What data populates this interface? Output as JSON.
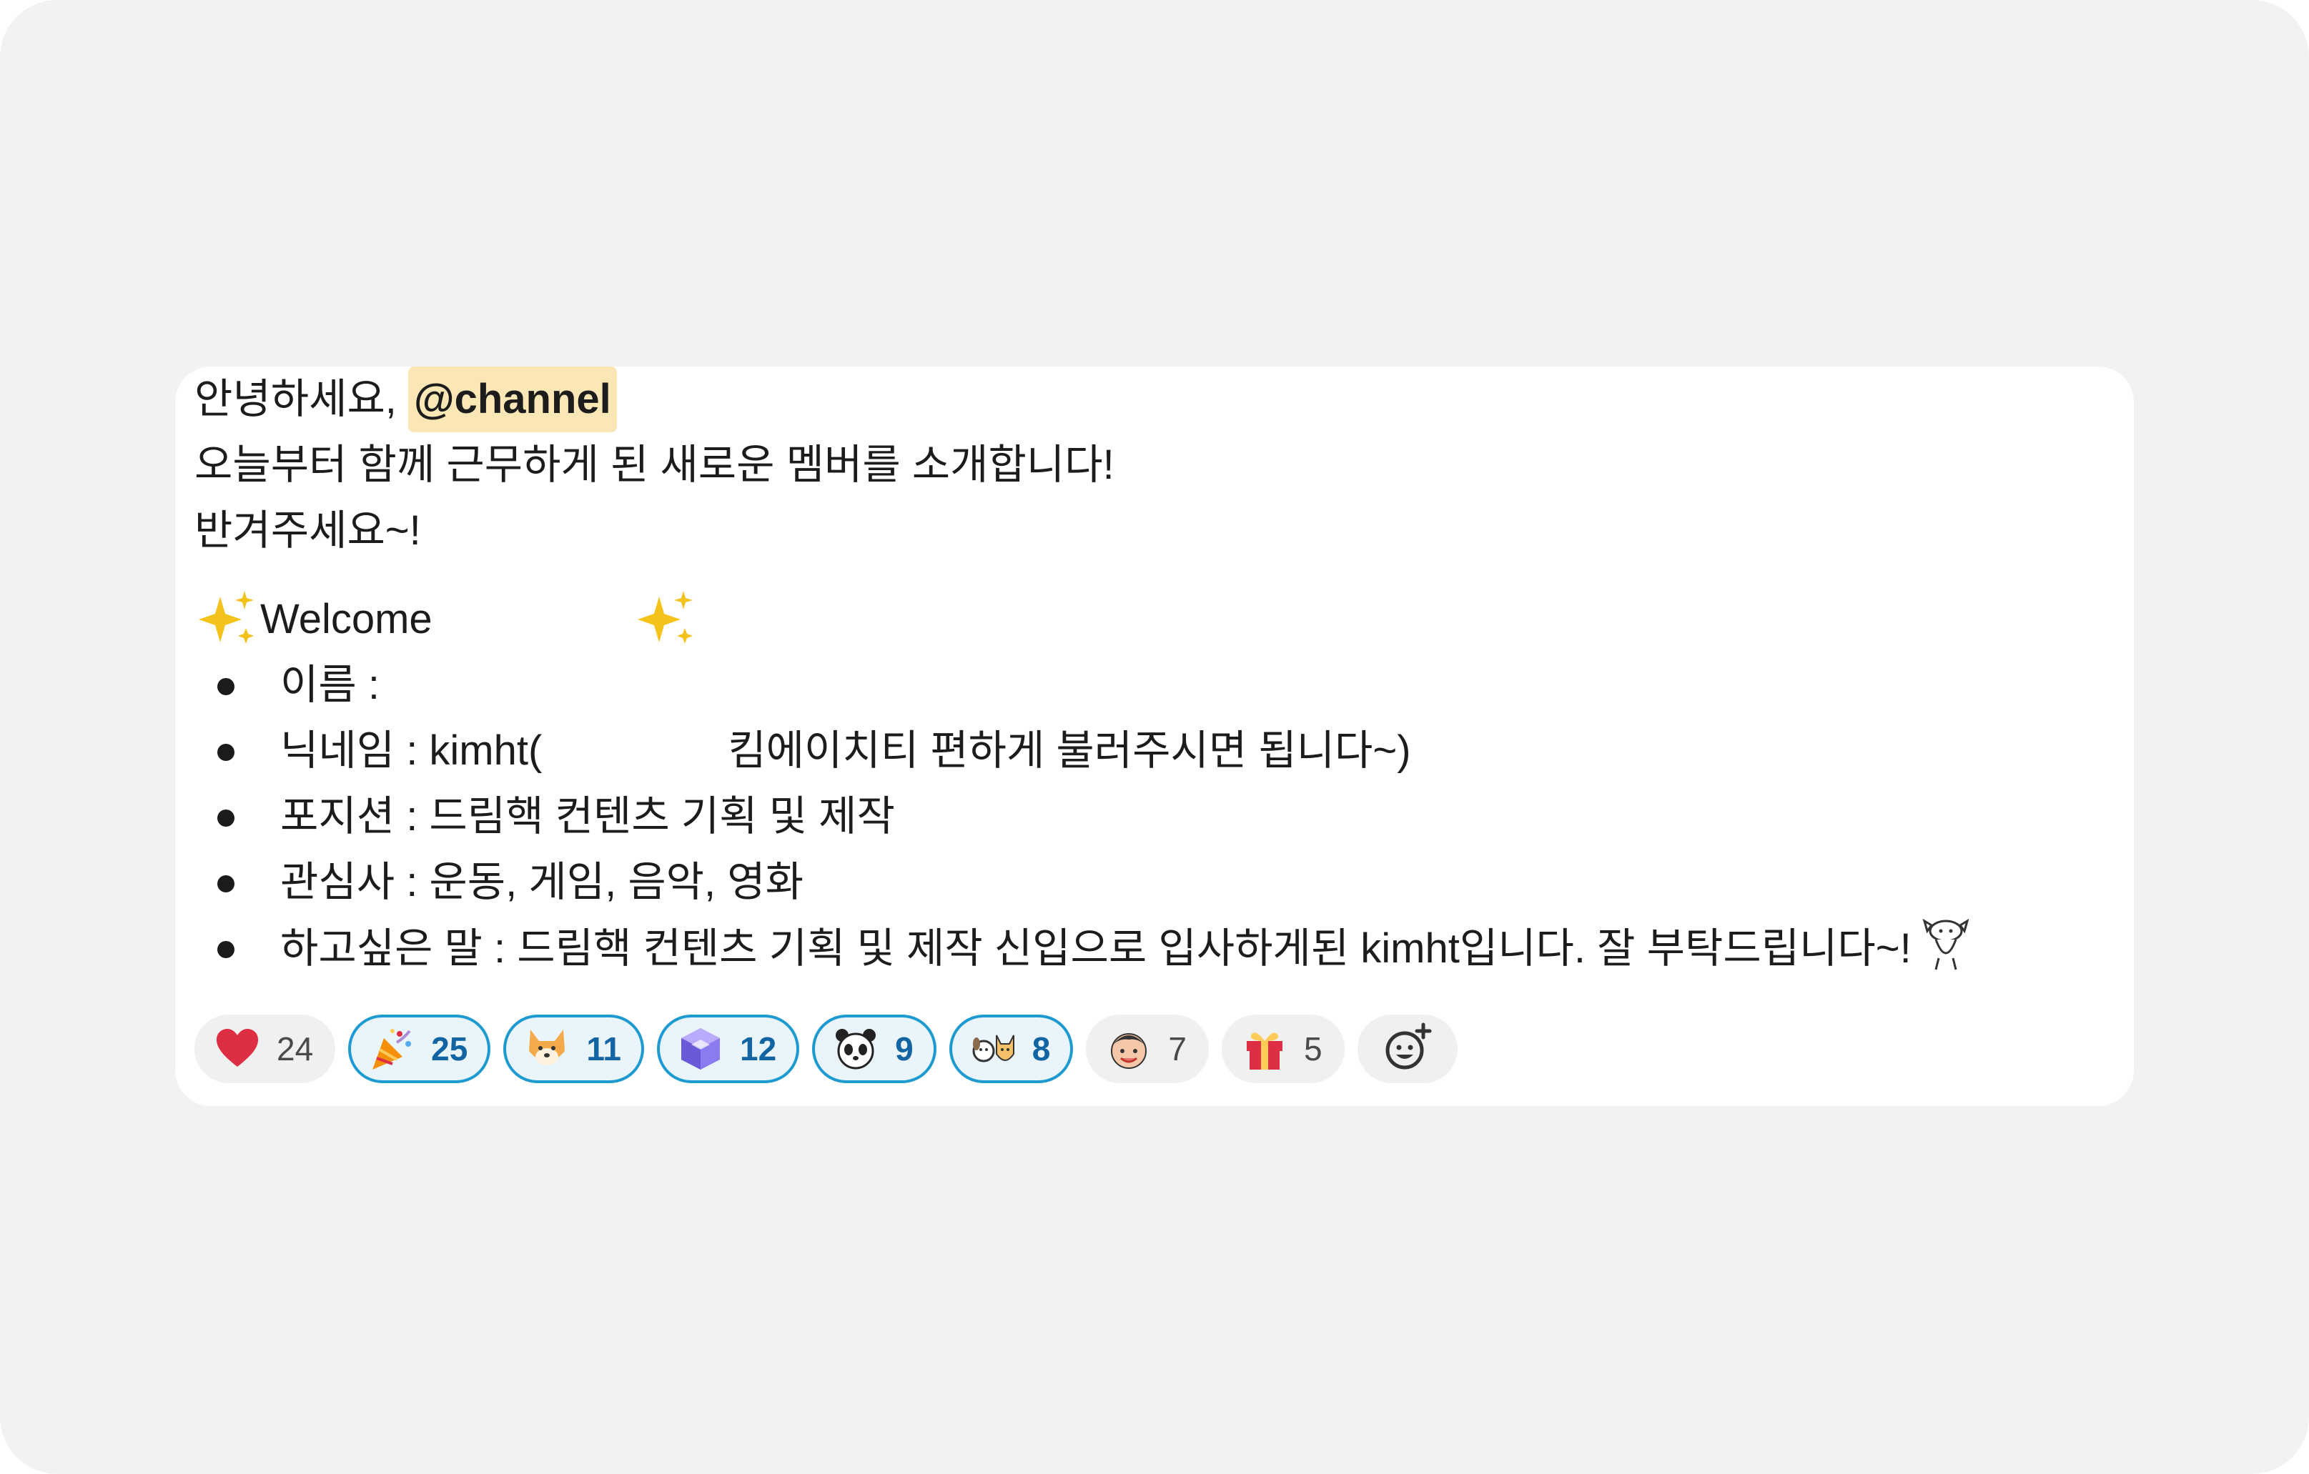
{
  "message": {
    "greeting": "안녕하세요, ",
    "mention": "@channel",
    "line2": "오늘부터 함께 근무하게 된 새로운 멤버를 소개합니다!",
    "line3": "반겨주세요~!",
    "welcome": "Welcome",
    "items": [
      {
        "label": "이름 :"
      },
      {
        "prefix": "닉네임 : kimht(",
        "suffix": "킴에이치티 편하게 불러주시면 됩니다~)"
      },
      {
        "label": "포지션 : 드림핵 컨텐츠 기획 및 제작"
      },
      {
        "label": "관심사 : 운동, 게임, 음악, 영화"
      },
      {
        "label": "하고싶은 말 : 드림핵 컨텐츠 기획 및 제작 신입으로 입사하게된 kimht입니다. 잘 부탁드립니다~!"
      }
    ]
  },
  "reactions": [
    {
      "icon": "heart-icon",
      "count": "24",
      "active": false
    },
    {
      "icon": "party-popper-icon",
      "count": "25",
      "active": true
    },
    {
      "icon": "shiba-dog-icon",
      "count": "11",
      "active": true
    },
    {
      "icon": "cube-logo-icon",
      "count": "12",
      "active": true
    },
    {
      "icon": "panda-icon",
      "count": "9",
      "active": true
    },
    {
      "icon": "dog-and-cat-icon",
      "count": "8",
      "active": true
    },
    {
      "icon": "face-character-icon",
      "count": "7",
      "active": false
    },
    {
      "icon": "gift-icon",
      "count": "5",
      "active": false
    }
  ],
  "colors": {
    "mention_bg": "#fbe7b6",
    "active_reaction_border": "#1d9bd1",
    "active_reaction_bg": "#eaf4fb",
    "active_reaction_text": "#1264a3",
    "page_bg": "#f2f2f2"
  }
}
